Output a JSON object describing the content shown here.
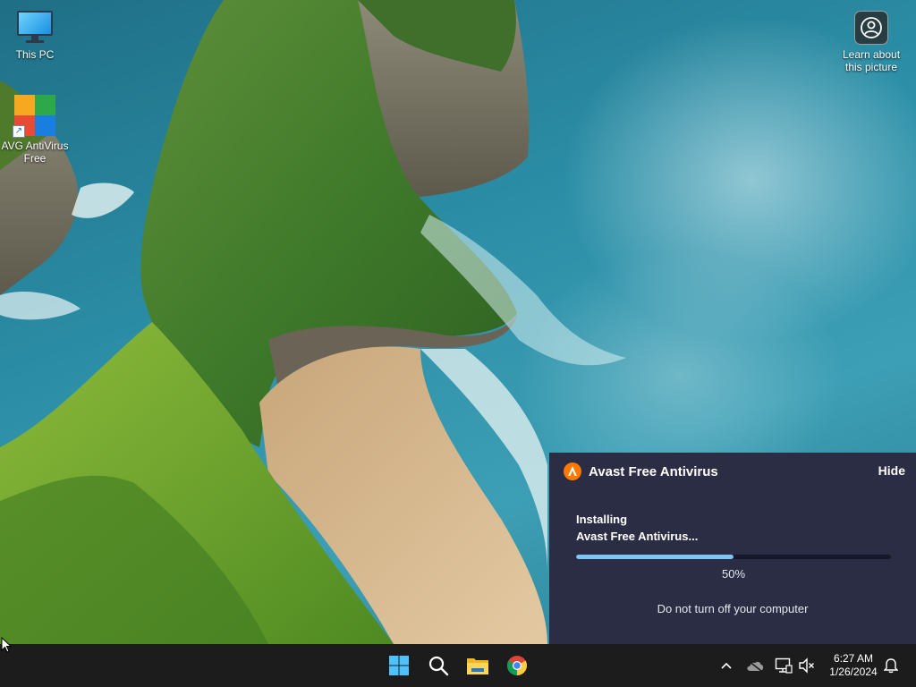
{
  "desktop": {
    "icons": [
      {
        "label": "This PC",
        "icon": "computer-icon"
      },
      {
        "label": "AVG AntiVirus Free",
        "icon": "avg-antivirus-icon"
      },
      {
        "label": "Learn about this picture",
        "icon": "camera-info-icon"
      }
    ]
  },
  "installer": {
    "app_name": "Avast Free Antivirus",
    "hide_label": "Hide",
    "status_line1": "Installing",
    "status_line2": "Avast Free Antivirus...",
    "progress": 0.5,
    "progress_text": "50%",
    "note": "Do not turn off your computer",
    "colors": {
      "panel": "#2b2d45",
      "accent": "#ff7800",
      "progress": "#7fc4f4"
    }
  },
  "taskbar": {
    "pinned": [
      "start-icon",
      "search-icon",
      "file-explorer-icon",
      "chrome-icon"
    ],
    "tray": [
      "chevron-up-icon",
      "onedrive-icon",
      "network-icon",
      "volume-muted-icon"
    ],
    "time": "6:27 AM",
    "date": "1/26/2024",
    "notification_icon": "bell-icon"
  }
}
